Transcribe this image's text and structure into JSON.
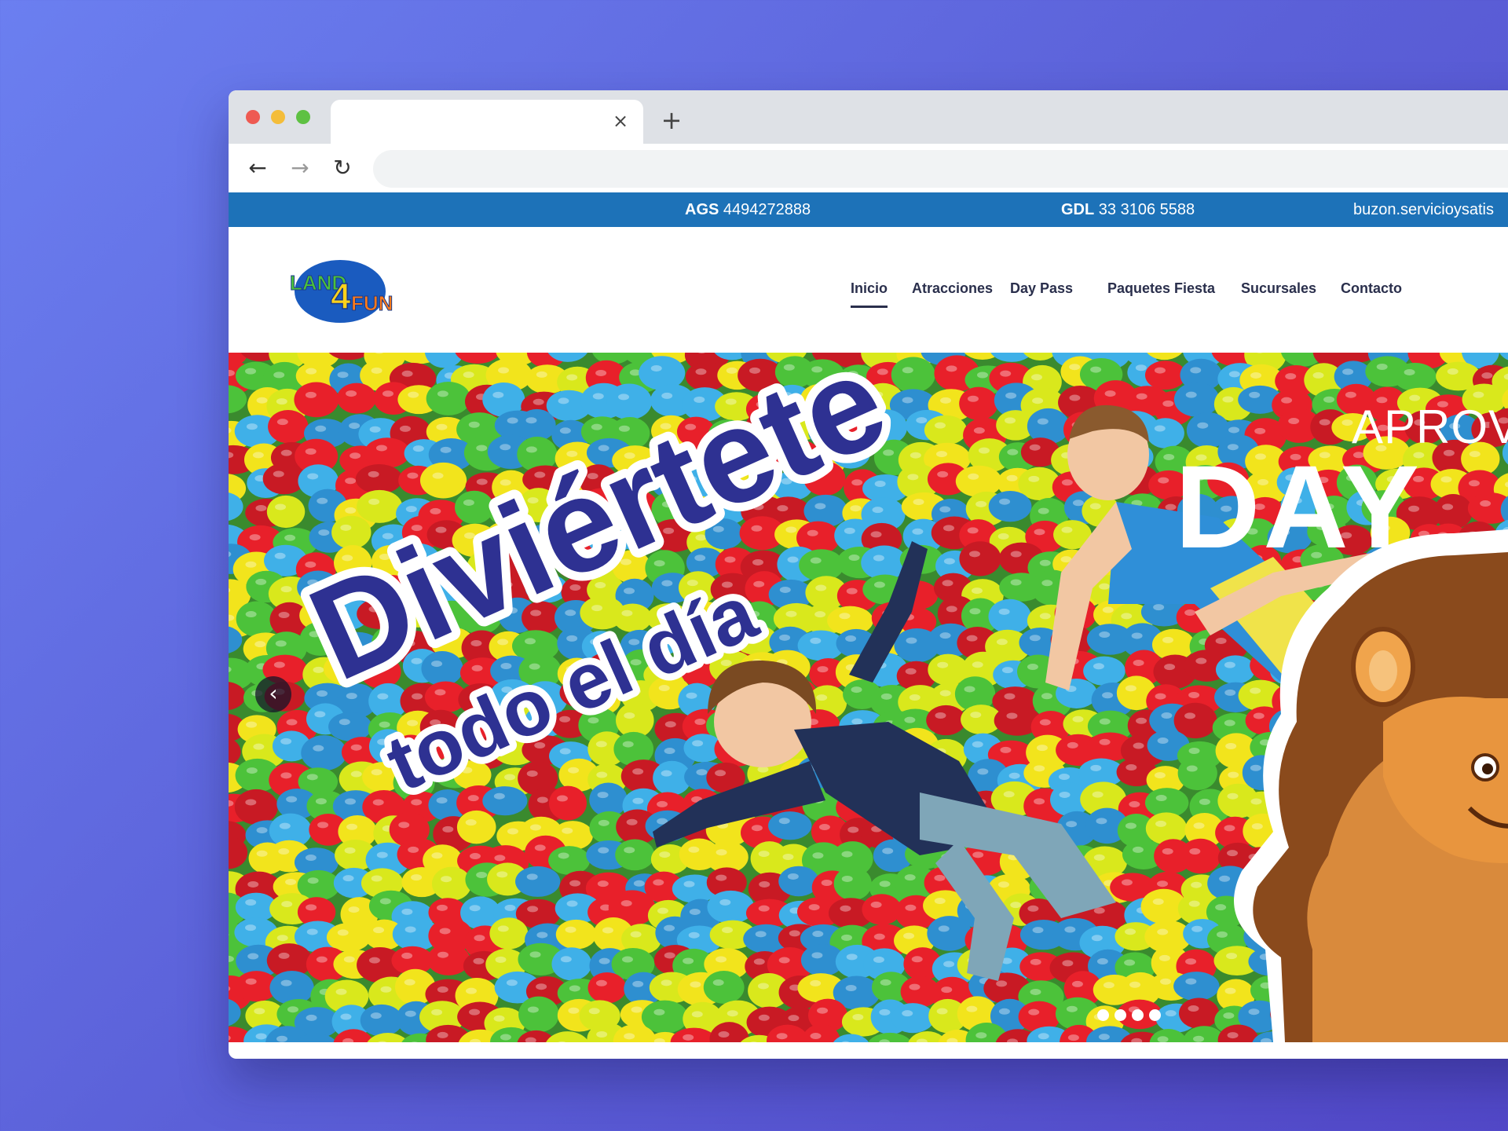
{
  "browser": {
    "tab_close": "×",
    "new_tab": "+",
    "back": "←",
    "forward": "→",
    "reload": "↻"
  },
  "topbar": {
    "ags_label": "AGS",
    "ags_phone": "4494272888",
    "gdl_label": "GDL",
    "gdl_phone": "33 3106 5588",
    "email": "buzon.servicioysatis"
  },
  "logo": {
    "text_land": "LAND",
    "text_4": "4",
    "text_fun": "FUN"
  },
  "nav": {
    "items": [
      "Inicio",
      "Atracciones",
      "Day Pass",
      "Paquetes Fiesta",
      "Sucursales",
      "Contacto"
    ],
    "active": "Inicio"
  },
  "hero": {
    "headline_1": "Diviértete",
    "headline_2": "todo el día",
    "promo_small": "APROV",
    "promo_big": "DAY",
    "prev": "‹",
    "slides": 4,
    "active_slide": 1
  },
  "colors": {
    "topbar": "#1d72b8",
    "headline": "#2e3192",
    "nav_text": "#2a2f4c"
  }
}
